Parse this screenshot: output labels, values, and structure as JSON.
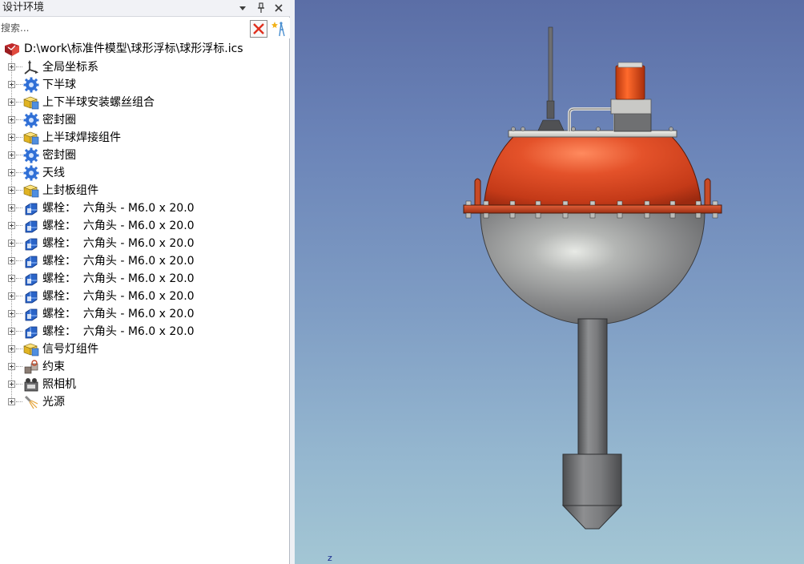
{
  "panel": {
    "title": "设计环境",
    "search_placeholder": "搜索...",
    "buttons": {
      "dropdown": "▼",
      "pin": "pin",
      "close": "✕"
    }
  },
  "tree": {
    "root_label": "D:\\work\\标准件模型\\球形浮标\\球形浮标.ics",
    "items": [
      {
        "label": "全局坐标系",
        "icon": "axes-icon"
      },
      {
        "label": "下半球",
        "icon": "part-gear-icon"
      },
      {
        "label": "上下半球安装螺丝组合",
        "icon": "assembly-icon"
      },
      {
        "label": "密封圈",
        "icon": "part-gear-icon"
      },
      {
        "label": "上半球焊接组件",
        "icon": "assembly-icon"
      },
      {
        "label": "密封圈",
        "icon": "part-gear-icon"
      },
      {
        "label": "天线",
        "icon": "part-gear-icon"
      },
      {
        "label": "上封板组件",
        "icon": "assembly-icon"
      },
      {
        "label": "螺栓：  六角头 - M6.0 x 20.0",
        "icon": "bolt-icon"
      },
      {
        "label": "螺栓：  六角头 - M6.0 x 20.0",
        "icon": "bolt-icon"
      },
      {
        "label": "螺栓：  六角头 - M6.0 x 20.0",
        "icon": "bolt-icon"
      },
      {
        "label": "螺栓：  六角头 - M6.0 x 20.0",
        "icon": "bolt-icon"
      },
      {
        "label": "螺栓：  六角头 - M6.0 x 20.0",
        "icon": "bolt-icon"
      },
      {
        "label": "螺栓：  六角头 - M6.0 x 20.0",
        "icon": "bolt-icon"
      },
      {
        "label": "螺栓：  六角头 - M6.0 x 20.0",
        "icon": "bolt-icon"
      },
      {
        "label": "螺栓：  六角头 - M6.0 x 20.0",
        "icon": "bolt-icon"
      },
      {
        "label": "信号灯组件",
        "icon": "assembly-icon"
      },
      {
        "label": "约束",
        "icon": "constraint-icon"
      },
      {
        "label": "照相机",
        "icon": "camera-icon"
      },
      {
        "label": "光源",
        "icon": "light-icon"
      }
    ]
  },
  "viewport": {
    "axis_label": "z",
    "model": "spherical-buoy",
    "colors": {
      "upper_hemisphere": "#d9431f",
      "lower_hemisphere": "#8a8b8c",
      "beacon": "#e05218",
      "background_top": "#5b6ea6",
      "background_bottom": "#a3c6d4"
    }
  }
}
